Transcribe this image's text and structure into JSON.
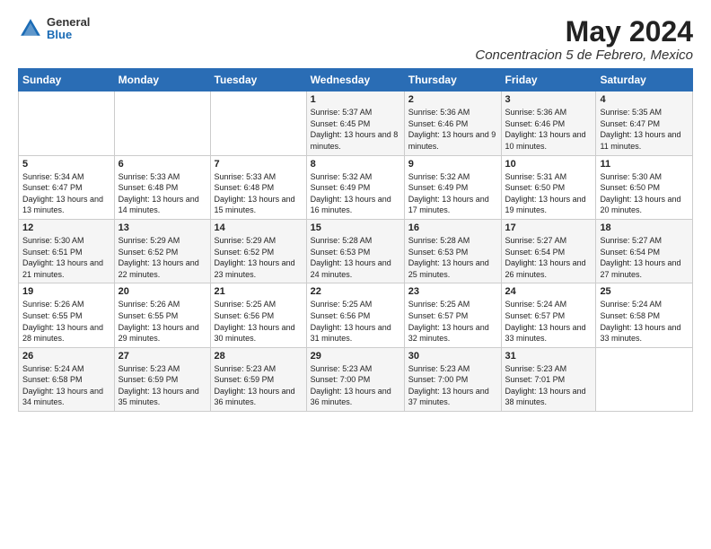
{
  "header": {
    "logo_general": "General",
    "logo_blue": "Blue",
    "month_title": "May 2024",
    "location": "Concentracion 5 de Febrero, Mexico"
  },
  "weekdays": [
    "Sunday",
    "Monday",
    "Tuesday",
    "Wednesday",
    "Thursday",
    "Friday",
    "Saturday"
  ],
  "weeks": [
    [
      {
        "day": "",
        "info": ""
      },
      {
        "day": "",
        "info": ""
      },
      {
        "day": "",
        "info": ""
      },
      {
        "day": "1",
        "info": "Sunrise: 5:37 AM\nSunset: 6:45 PM\nDaylight: 13 hours and 8 minutes."
      },
      {
        "day": "2",
        "info": "Sunrise: 5:36 AM\nSunset: 6:46 PM\nDaylight: 13 hours and 9 minutes."
      },
      {
        "day": "3",
        "info": "Sunrise: 5:36 AM\nSunset: 6:46 PM\nDaylight: 13 hours and 10 minutes."
      },
      {
        "day": "4",
        "info": "Sunrise: 5:35 AM\nSunset: 6:47 PM\nDaylight: 13 hours and 11 minutes."
      }
    ],
    [
      {
        "day": "5",
        "info": "Sunrise: 5:34 AM\nSunset: 6:47 PM\nDaylight: 13 hours and 13 minutes."
      },
      {
        "day": "6",
        "info": "Sunrise: 5:33 AM\nSunset: 6:48 PM\nDaylight: 13 hours and 14 minutes."
      },
      {
        "day": "7",
        "info": "Sunrise: 5:33 AM\nSunset: 6:48 PM\nDaylight: 13 hours and 15 minutes."
      },
      {
        "day": "8",
        "info": "Sunrise: 5:32 AM\nSunset: 6:49 PM\nDaylight: 13 hours and 16 minutes."
      },
      {
        "day": "9",
        "info": "Sunrise: 5:32 AM\nSunset: 6:49 PM\nDaylight: 13 hours and 17 minutes."
      },
      {
        "day": "10",
        "info": "Sunrise: 5:31 AM\nSunset: 6:50 PM\nDaylight: 13 hours and 19 minutes."
      },
      {
        "day": "11",
        "info": "Sunrise: 5:30 AM\nSunset: 6:50 PM\nDaylight: 13 hours and 20 minutes."
      }
    ],
    [
      {
        "day": "12",
        "info": "Sunrise: 5:30 AM\nSunset: 6:51 PM\nDaylight: 13 hours and 21 minutes."
      },
      {
        "day": "13",
        "info": "Sunrise: 5:29 AM\nSunset: 6:52 PM\nDaylight: 13 hours and 22 minutes."
      },
      {
        "day": "14",
        "info": "Sunrise: 5:29 AM\nSunset: 6:52 PM\nDaylight: 13 hours and 23 minutes."
      },
      {
        "day": "15",
        "info": "Sunrise: 5:28 AM\nSunset: 6:53 PM\nDaylight: 13 hours and 24 minutes."
      },
      {
        "day": "16",
        "info": "Sunrise: 5:28 AM\nSunset: 6:53 PM\nDaylight: 13 hours and 25 minutes."
      },
      {
        "day": "17",
        "info": "Sunrise: 5:27 AM\nSunset: 6:54 PM\nDaylight: 13 hours and 26 minutes."
      },
      {
        "day": "18",
        "info": "Sunrise: 5:27 AM\nSunset: 6:54 PM\nDaylight: 13 hours and 27 minutes."
      }
    ],
    [
      {
        "day": "19",
        "info": "Sunrise: 5:26 AM\nSunset: 6:55 PM\nDaylight: 13 hours and 28 minutes."
      },
      {
        "day": "20",
        "info": "Sunrise: 5:26 AM\nSunset: 6:55 PM\nDaylight: 13 hours and 29 minutes."
      },
      {
        "day": "21",
        "info": "Sunrise: 5:25 AM\nSunset: 6:56 PM\nDaylight: 13 hours and 30 minutes."
      },
      {
        "day": "22",
        "info": "Sunrise: 5:25 AM\nSunset: 6:56 PM\nDaylight: 13 hours and 31 minutes."
      },
      {
        "day": "23",
        "info": "Sunrise: 5:25 AM\nSunset: 6:57 PM\nDaylight: 13 hours and 32 minutes."
      },
      {
        "day": "24",
        "info": "Sunrise: 5:24 AM\nSunset: 6:57 PM\nDaylight: 13 hours and 33 minutes."
      },
      {
        "day": "25",
        "info": "Sunrise: 5:24 AM\nSunset: 6:58 PM\nDaylight: 13 hours and 33 minutes."
      }
    ],
    [
      {
        "day": "26",
        "info": "Sunrise: 5:24 AM\nSunset: 6:58 PM\nDaylight: 13 hours and 34 minutes."
      },
      {
        "day": "27",
        "info": "Sunrise: 5:23 AM\nSunset: 6:59 PM\nDaylight: 13 hours and 35 minutes."
      },
      {
        "day": "28",
        "info": "Sunrise: 5:23 AM\nSunset: 6:59 PM\nDaylight: 13 hours and 36 minutes."
      },
      {
        "day": "29",
        "info": "Sunrise: 5:23 AM\nSunset: 7:00 PM\nDaylight: 13 hours and 36 minutes."
      },
      {
        "day": "30",
        "info": "Sunrise: 5:23 AM\nSunset: 7:00 PM\nDaylight: 13 hours and 37 minutes."
      },
      {
        "day": "31",
        "info": "Sunrise: 5:23 AM\nSunset: 7:01 PM\nDaylight: 13 hours and 38 minutes."
      },
      {
        "day": "",
        "info": ""
      }
    ]
  ]
}
